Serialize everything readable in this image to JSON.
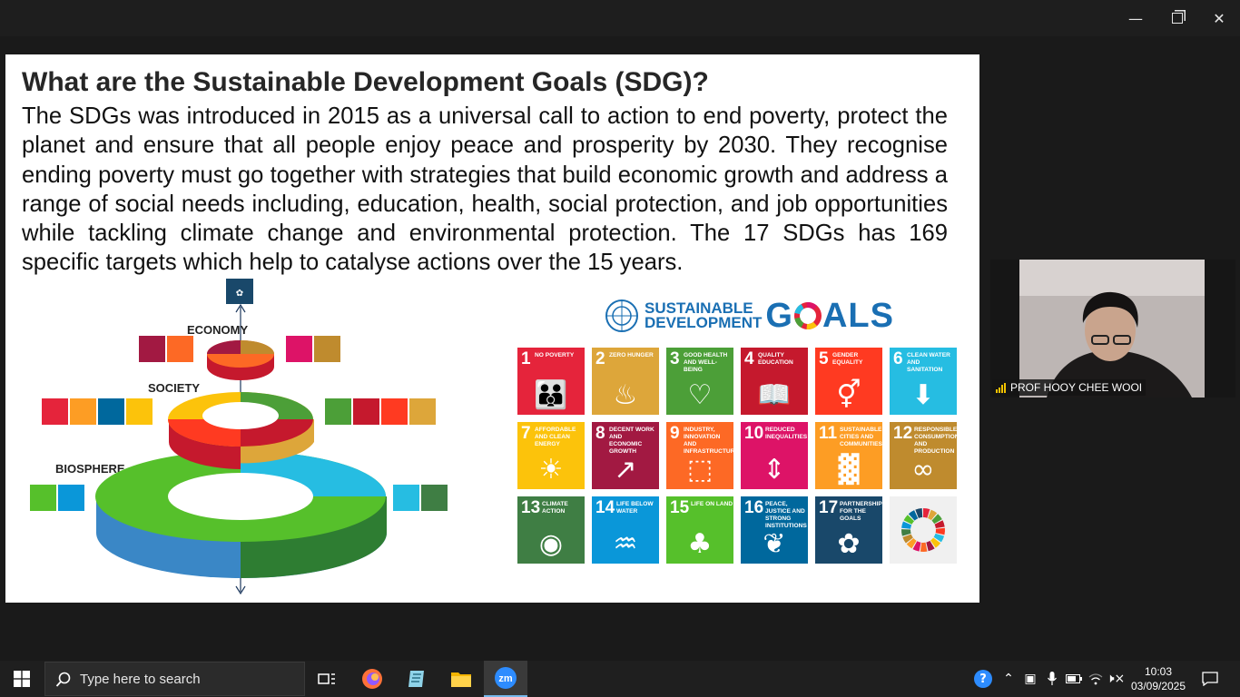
{
  "window": {
    "minimize_icon": "minimize-icon",
    "restore_icon": "restore-icon",
    "close_icon": "close-icon"
  },
  "slide": {
    "title": "What are the Sustainable Development Goals (SDG)?",
    "body": "The SDGs was introduced in 2015 as a universal call to action to end poverty, protect the planet and ensure that all people enjoy peace and prosperity by 2030. They recognise ending poverty must go together with strategies that build economic growth and address a range of social needs including, education, health, social protection, and job opportunities while tackling climate change and environmental protection. The 17 SDGs has 169 specific targets which help to catalyse actions over the 15 years."
  },
  "diagram": {
    "economy_label": "ECONOMY",
    "society_label": "SOCIETY",
    "biosphere_label": "BIOSPHERE"
  },
  "logo": {
    "line1": "SUSTAINABLE",
    "line2": "DEVELOPMENT",
    "goals": "G",
    "goals_rest": "ALS"
  },
  "goals": [
    {
      "num": "1",
      "label": "No Poverty",
      "color": "#e5243b",
      "icon": "people-icon"
    },
    {
      "num": "2",
      "label": "Zero Hunger",
      "color": "#dda63a",
      "icon": "bowl-icon"
    },
    {
      "num": "3",
      "label": "Good Health and Well-Being",
      "color": "#4c9f38",
      "icon": "heartbeat-icon"
    },
    {
      "num": "4",
      "label": "Quality Education",
      "color": "#c5192d",
      "icon": "book-icon"
    },
    {
      "num": "5",
      "label": "Gender Equality",
      "color": "#ff3a21",
      "icon": "gender-icon"
    },
    {
      "num": "6",
      "label": "Clean Water and Sanitation",
      "color": "#26bde2",
      "icon": "water-icon"
    },
    {
      "num": "7",
      "label": "Affordable and Clean Energy",
      "color": "#fcc30b",
      "icon": "sun-icon"
    },
    {
      "num": "8",
      "label": "Decent Work and Economic Growth",
      "color": "#a21942",
      "icon": "growth-icon"
    },
    {
      "num": "9",
      "label": "Industry, Innovation and Infrastructure",
      "color": "#fd6925",
      "icon": "cubes-icon"
    },
    {
      "num": "10",
      "label": "Reduced Inequalities",
      "color": "#dd1367",
      "icon": "equality-icon"
    },
    {
      "num": "11",
      "label": "Sustainable Cities and Communities",
      "color": "#fd9d24",
      "icon": "city-icon"
    },
    {
      "num": "12",
      "label": "Responsible Consumption and Production",
      "color": "#bf8b2e",
      "icon": "infinity-icon"
    },
    {
      "num": "13",
      "label": "Climate Action",
      "color": "#3f7e44",
      "icon": "eye-globe-icon"
    },
    {
      "num": "14",
      "label": "Life Below Water",
      "color": "#0a97d9",
      "icon": "fish-icon"
    },
    {
      "num": "15",
      "label": "Life On Land",
      "color": "#56c02b",
      "icon": "tree-icon"
    },
    {
      "num": "16",
      "label": "Peace, Justice and Strong Institutions",
      "color": "#00689d",
      "icon": "dove-icon"
    },
    {
      "num": "17",
      "label": "Partnerships for the Goals",
      "color": "#19486a",
      "icon": "rings-icon"
    }
  ],
  "video": {
    "participant_name": "PROF HOOY CHEE WOOI"
  },
  "taskbar": {
    "search_placeholder": "Type here to search",
    "time": "10:03",
    "date": "03/09/2025"
  }
}
